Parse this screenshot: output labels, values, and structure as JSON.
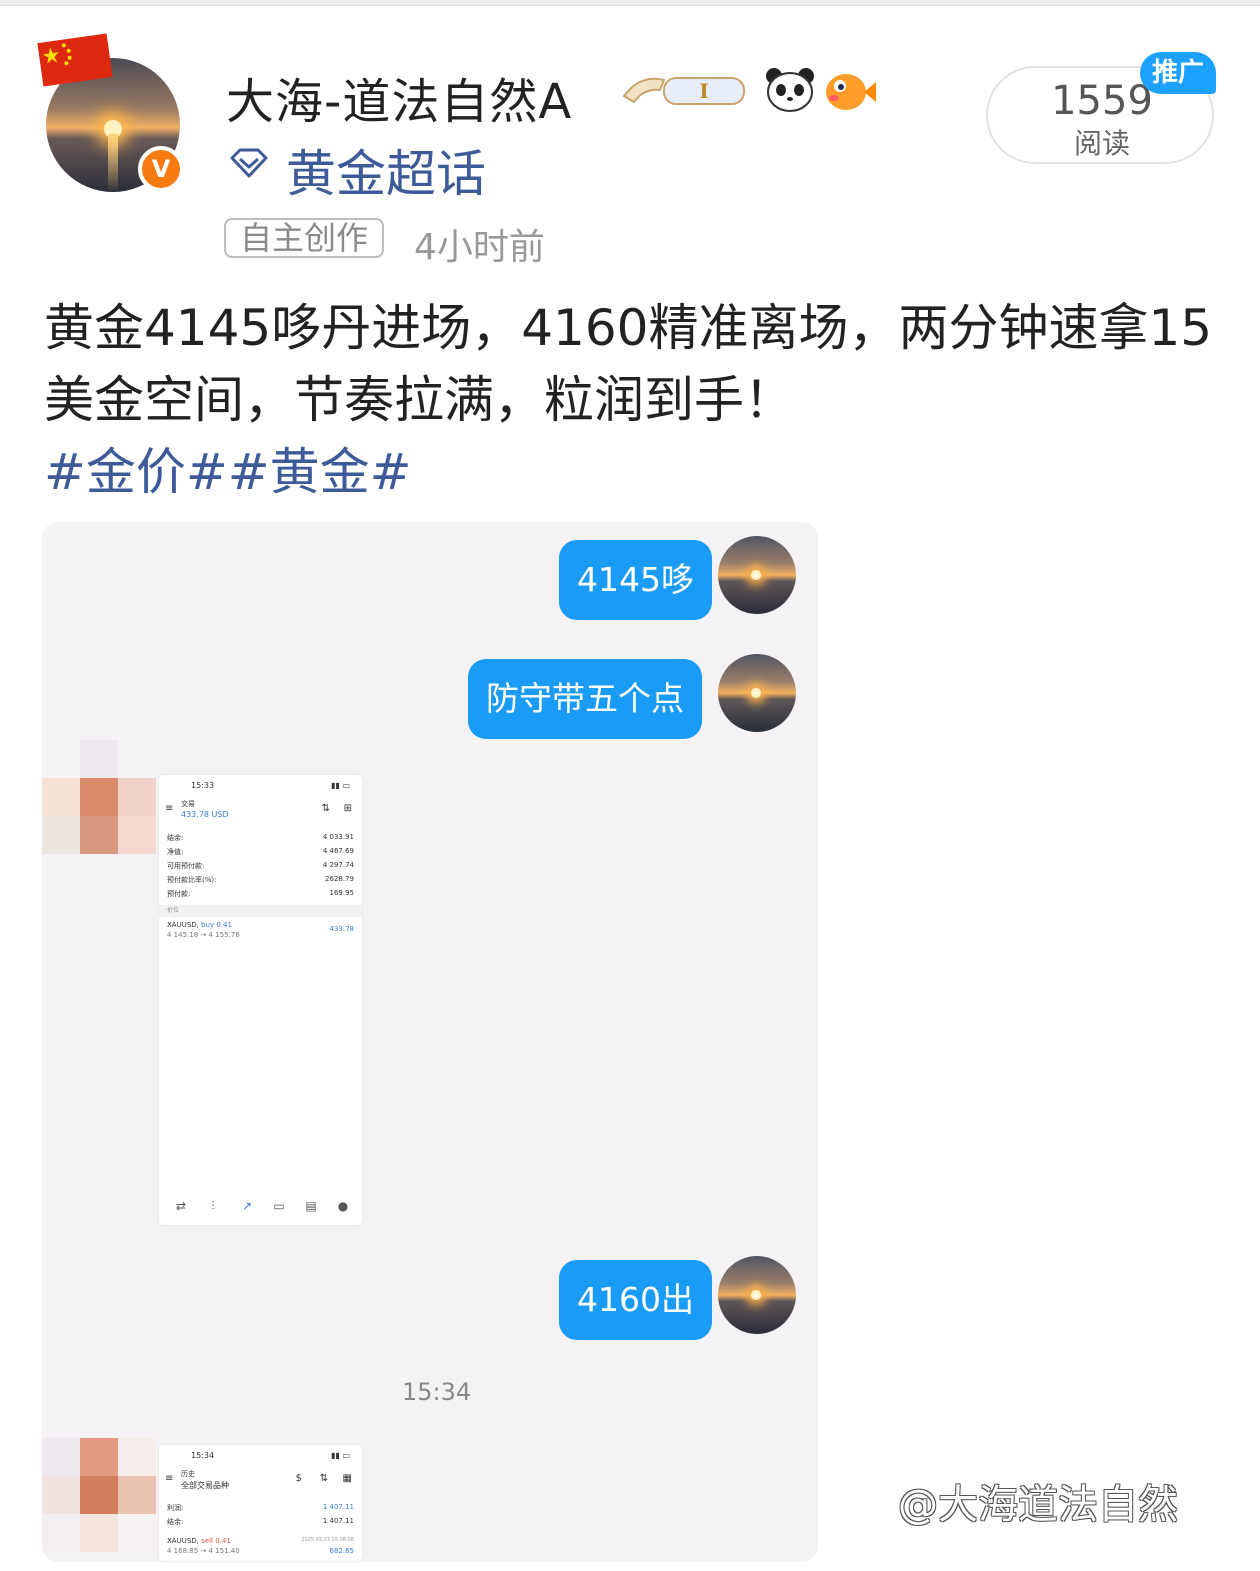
{
  "post": {
    "author_name": "大海-道法自然A",
    "super_topic": "黄金超话",
    "tag": "自主创作",
    "posted_time": "4小时前",
    "reads_count": "1559",
    "reads_label": "阅读",
    "promo_badge": "推广",
    "content": "黄金4145哆丹进场，4160精准离场，两分钟速拿15美金空间，节奏拉满，粒润到手！",
    "hashtags": "#金价##黄金#"
  },
  "chat": {
    "messages": [
      "4145哆",
      "防守带五个点",
      "4160出"
    ],
    "timestamp": "15:34",
    "screenshot1": {
      "status_time": "15:33",
      "section": "交易",
      "balance_usd": "433.78 USD",
      "rows": [
        {
          "k": "结余:",
          "v": "4 033.91"
        },
        {
          "k": "净值:",
          "v": "4 467.69"
        },
        {
          "k": "可用预付款:",
          "v": "4 297.74"
        },
        {
          "k": "预付款比率(%):",
          "v": "2628.79"
        },
        {
          "k": "预付款:",
          "v": "169.95"
        }
      ],
      "positions_header": "价位",
      "position": {
        "symbol": "XAUUSD,",
        "side": "buy 0.41",
        "range": "4 145.18 → 4 155.76",
        "profit": "433.78"
      }
    },
    "screenshot2": {
      "status_time": "15:34",
      "section": "历史",
      "filter": "全部交易品种",
      "rows": [
        {
          "k": "利润:",
          "v": "1 407.11"
        },
        {
          "k": "结余:",
          "v": "1 407.11"
        }
      ],
      "position": {
        "symbol": "XAUUSD,",
        "side": "sell 0.41",
        "range": "4 168.85 → 4 151.40",
        "date": "2025.03.23 15:08:58",
        "profit": "682.65"
      }
    }
  },
  "watermark": "@大海道法自然",
  "colors": {
    "accent": "#1a9bf5",
    "topic_blue": "#3d5a99",
    "verified_orange": "#f77b12"
  }
}
